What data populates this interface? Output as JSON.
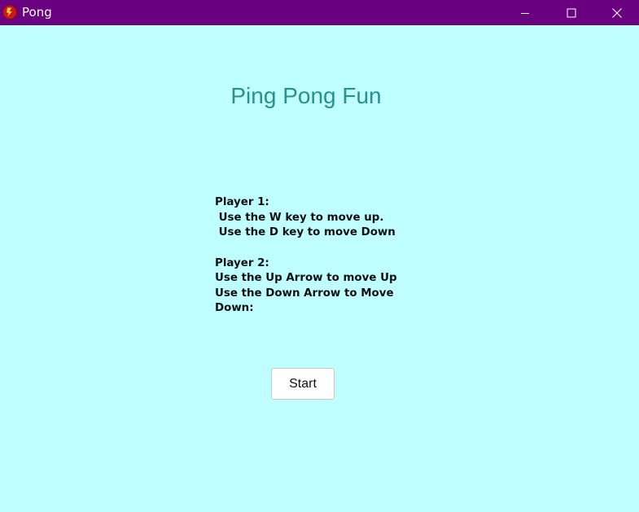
{
  "window": {
    "title": "Pong",
    "app_icon": "pong-app-icon",
    "controls": {
      "minimize_icon": "minimize-icon",
      "maximize_icon": "maximize-icon",
      "close_icon": "close-icon"
    },
    "titlebar_color": "#6a007f",
    "background_color": "#c0ffff"
  },
  "main": {
    "heading": "Ping Pong Fun",
    "heading_color": "#2a8f8f",
    "instructions": {
      "player1_title": "Player 1:",
      "player1_line1": " Use the W key to move up.",
      "player1_line2": " Use the D key to move Down",
      "player2_title": "Player 2:",
      "player2_line1": "Use the Up Arrow to move Up",
      "player2_line2": "Use the Down Arrow to Move Down:"
    },
    "start_label": "Start"
  }
}
